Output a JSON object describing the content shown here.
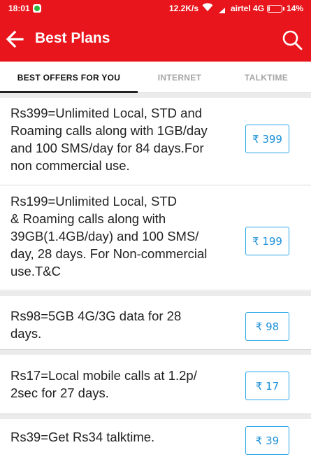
{
  "status_bar": {
    "time": "18:01",
    "network_speed": "12.2K/s",
    "carrier": "airtel 4G",
    "battery_percent": "14%",
    "battery_level": 0.14
  },
  "header": {
    "title": "Best Plans",
    "background_color": "#e8161c"
  },
  "tabs": [
    {
      "label": "BEST OFFERS FOR YOU",
      "active": true
    },
    {
      "label": "INTERNET",
      "active": false
    },
    {
      "label": "TALKTIME",
      "active": false
    }
  ],
  "plans": [
    {
      "description": "Rs399=Unlimited Local, STD and\nRoaming calls along with 1GB/day\nand 100 SMS/day for 84 days.For\nnon commercial use.",
      "price": "₹ 399"
    },
    {
      "description": "Rs199=Unlimited Local, STD\n& Roaming calls along with\n39GB(1.4GB/day) and 100 SMS/\nday, 28 days. For Non-commercial\nuse.T&C",
      "price": "₹ 199"
    },
    {
      "description": "Rs98=5GB 4G/3G data for 28\ndays.",
      "price": "₹ 98"
    },
    {
      "description": "Rs17=Local mobile calls at 1.2p/\n2sec for 27 days.",
      "price": "₹ 17"
    },
    {
      "description": "Rs39=Get Rs34 talktime.",
      "price": "₹ 39"
    }
  ],
  "colors": {
    "accent": "#e8161c",
    "price_button": "#1a8fd8"
  }
}
